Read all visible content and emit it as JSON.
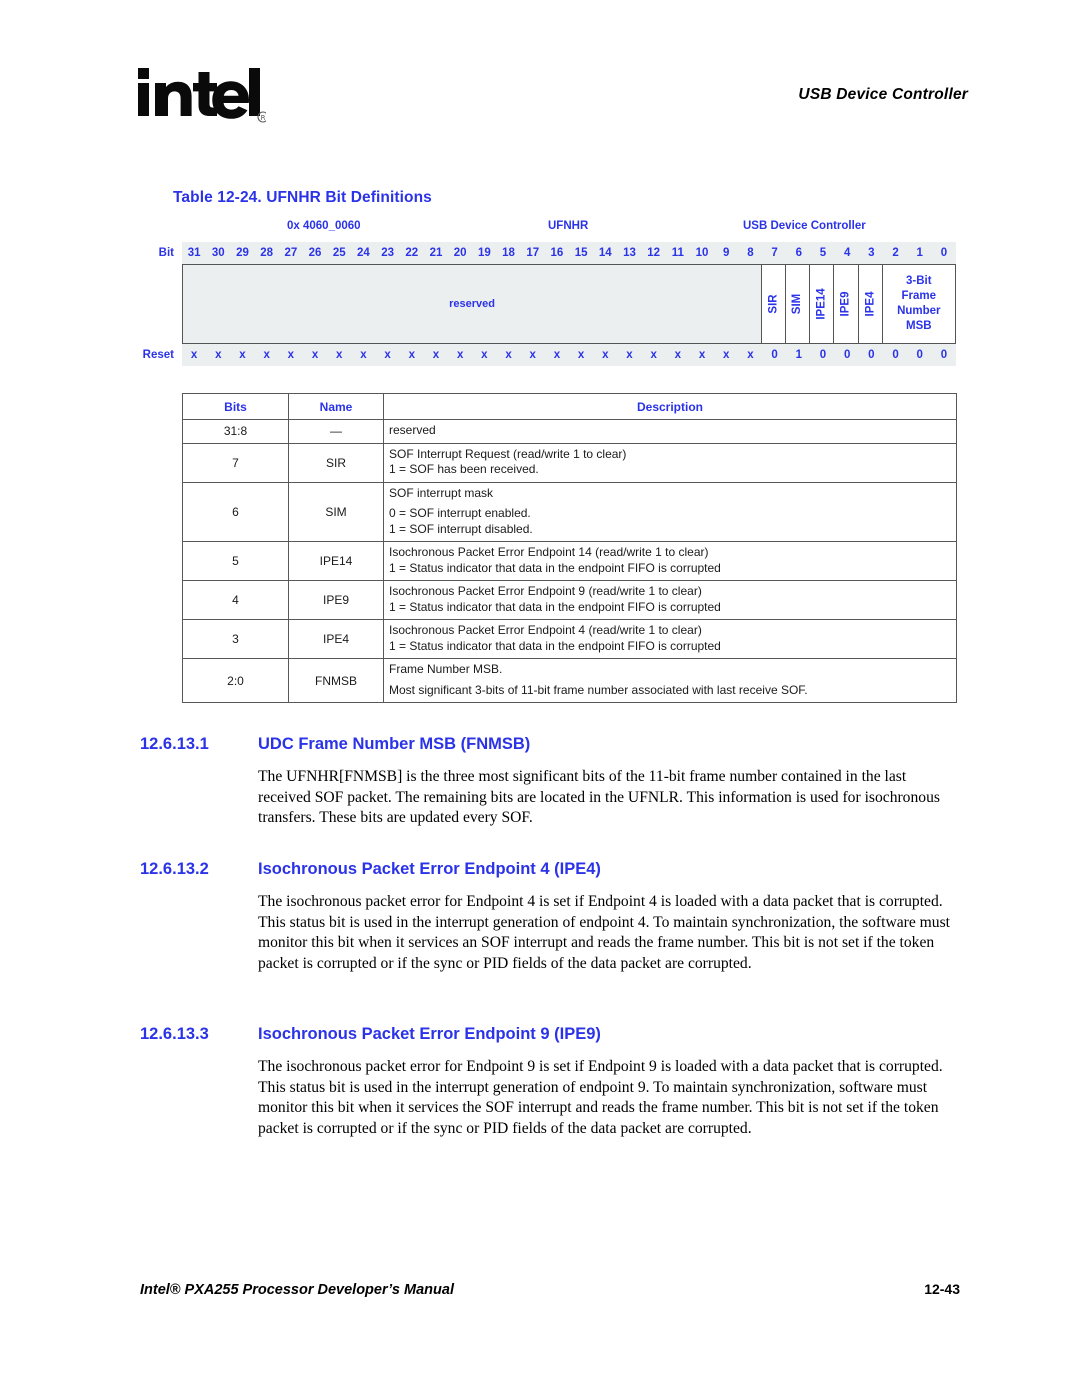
{
  "header": {
    "logo_alt": "intel",
    "title": "USB Device Controller"
  },
  "table": {
    "title": "Table 12-24. UFNHR Bit Definitions",
    "register": {
      "address": "0x 4060_0060",
      "name": "UFNHR",
      "unit": "USB Device Controller"
    },
    "bit_row_label": "Bit",
    "reset_row_label": "Reset",
    "bit_numbers": [
      "31",
      "30",
      "29",
      "28",
      "27",
      "26",
      "25",
      "24",
      "23",
      "22",
      "21",
      "20",
      "19",
      "18",
      "17",
      "16",
      "15",
      "14",
      "13",
      "12",
      "11",
      "10",
      "9",
      "8",
      "7",
      "6",
      "5",
      "4",
      "3",
      "2",
      "1",
      "0"
    ],
    "reset_values": [
      "x",
      "x",
      "x",
      "x",
      "x",
      "x",
      "x",
      "x",
      "x",
      "x",
      "x",
      "x",
      "x",
      "x",
      "x",
      "x",
      "x",
      "x",
      "x",
      "x",
      "x",
      "x",
      "x",
      "x",
      "0",
      "1",
      "0",
      "0",
      "0",
      "0",
      "0",
      "0"
    ],
    "fields": [
      {
        "label": "reserved",
        "bits": 24,
        "orientation": "horizontal",
        "shaded": true
      },
      {
        "label": "SIR",
        "bits": 1,
        "orientation": "vertical",
        "shaded": false
      },
      {
        "label": "SIM",
        "bits": 1,
        "orientation": "vertical",
        "shaded": false
      },
      {
        "label": "IPE14",
        "bits": 1,
        "orientation": "vertical",
        "shaded": false
      },
      {
        "label": "IPE9",
        "bits": 1,
        "orientation": "vertical",
        "shaded": false
      },
      {
        "label": "IPE4",
        "bits": 1,
        "orientation": "vertical",
        "shaded": false
      },
      {
        "label": "3-Bit\nFrame\nNumber\nMSB",
        "bits": 3,
        "orientation": "multiline",
        "shaded": false
      }
    ],
    "columns": [
      "Bits",
      "Name",
      "Description"
    ],
    "rows": [
      {
        "bits": "31:8",
        "name": "—",
        "desc_lines": [
          "reserved"
        ]
      },
      {
        "bits": "7",
        "name": "SIR",
        "desc_lines": [
          "SOF Interrupt Request (read/write 1 to clear)",
          "1 =  SOF has been received."
        ]
      },
      {
        "bits": "6",
        "name": "SIM",
        "desc_lines": [
          "SOF interrupt mask",
          "",
          "0 =  SOF interrupt enabled.",
          "1 =  SOF interrupt disabled."
        ]
      },
      {
        "bits": "5",
        "name": "IPE14",
        "desc_lines": [
          "Isochronous Packet Error Endpoint 14 (read/write 1 to clear)",
          "1 =  Status indicator that data in the endpoint FIFO is corrupted"
        ]
      },
      {
        "bits": "4",
        "name": "IPE9",
        "desc_lines": [
          "Isochronous Packet Error Endpoint 9 (read/write 1 to clear)",
          "1 =  Status indicator that data in the endpoint FIFO is corrupted"
        ]
      },
      {
        "bits": "3",
        "name": "IPE4",
        "desc_lines": [
          "Isochronous Packet Error Endpoint 4 (read/write 1 to clear)",
          "1 =  Status indicator that data in the endpoint FIFO is corrupted"
        ]
      },
      {
        "bits": "2:0",
        "name": "FNMSB",
        "desc_lines": [
          "Frame Number MSB.",
          "",
          "Most significant 3-bits of 11-bit frame number associated with last receive SOF."
        ]
      }
    ]
  },
  "sections": [
    {
      "number": "12.6.13.1",
      "title": "UDC Frame Number MSB (FNMSB)",
      "body": "The UFNHR[FNMSB] is the three most significant bits of the 11-bit frame number contained in the last received SOF packet. The remaining bits are located in the UFNLR. This information is used for isochronous transfers. These bits are updated every SOF."
    },
    {
      "number": "12.6.13.2",
      "title": "Isochronous Packet Error Endpoint 4 (IPE4)",
      "body": "The isochronous packet error for Endpoint 4 is set if Endpoint 4 is loaded with a data packet that is corrupted. This status bit is used in the interrupt generation of endpoint 4. To maintain synchronization, the software must monitor this bit when it services an SOF interrupt and reads the frame number. This bit is not set if the token packet is corrupted or if the sync or PID fields of the data packet are corrupted."
    },
    {
      "number": "12.6.13.3",
      "title": "Isochronous Packet Error Endpoint 9 (IPE9)",
      "body": "The isochronous packet error for Endpoint 9 is set if Endpoint 9 is loaded with a data packet that is corrupted. This status bit is used in the interrupt generation of endpoint 9. To maintain synchronization, software must monitor this bit when it services the SOF interrupt and reads the frame number. This bit is not set if the token packet is corrupted or if the sync or PID fields of the data packet are corrupted."
    }
  ],
  "footer": {
    "left": "Intel® PXA255 Processor Developer’s Manual",
    "right": "12-43"
  },
  "colors": {
    "heading_blue": "#2b33e8",
    "shaded_field": "#eceff0",
    "border_gray": "#585858"
  }
}
